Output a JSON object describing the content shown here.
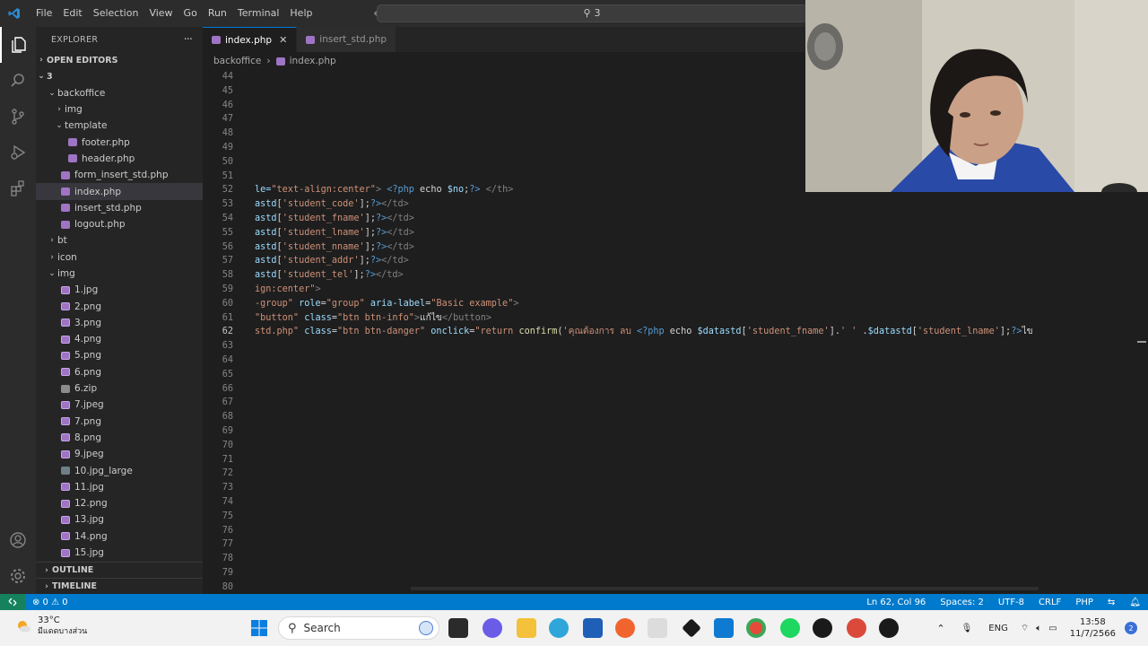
{
  "menu": [
    "File",
    "Edit",
    "Selection",
    "View",
    "Go",
    "Run",
    "Terminal",
    "Help"
  ],
  "command_center": "3",
  "explorer": {
    "title": "EXPLORER",
    "more": "···",
    "open_editors": "OPEN EDITORS",
    "root": "3",
    "tree": [
      {
        "label": "backoffice",
        "depth": 1,
        "kind": "folder-open"
      },
      {
        "label": "img",
        "depth": 2,
        "kind": "folder"
      },
      {
        "label": "template",
        "depth": 2,
        "kind": "folder-open"
      },
      {
        "label": "footer.php",
        "depth": 3,
        "kind": "php"
      },
      {
        "label": "header.php",
        "depth": 3,
        "kind": "php"
      },
      {
        "label": "form_insert_std.php",
        "depth": 2,
        "kind": "php"
      },
      {
        "label": "index.php",
        "depth": 2,
        "kind": "php",
        "selected": true
      },
      {
        "label": "insert_std.php",
        "depth": 2,
        "kind": "php"
      },
      {
        "label": "logout.php",
        "depth": 2,
        "kind": "php"
      },
      {
        "label": "bt",
        "depth": 1,
        "kind": "folder"
      },
      {
        "label": "icon",
        "depth": 1,
        "kind": "folder"
      },
      {
        "label": "img",
        "depth": 1,
        "kind": "folder-open"
      },
      {
        "label": "1.jpg",
        "depth": 2,
        "kind": "img"
      },
      {
        "label": "2.png",
        "depth": 2,
        "kind": "img"
      },
      {
        "label": "3.png",
        "depth": 2,
        "kind": "img"
      },
      {
        "label": "4.png",
        "depth": 2,
        "kind": "img"
      },
      {
        "label": "5.png",
        "depth": 2,
        "kind": "img"
      },
      {
        "label": "6.png",
        "depth": 2,
        "kind": "img"
      },
      {
        "label": "6.zip",
        "depth": 2,
        "kind": "zip"
      },
      {
        "label": "7.jpeg",
        "depth": 2,
        "kind": "img"
      },
      {
        "label": "7.png",
        "depth": 2,
        "kind": "img"
      },
      {
        "label": "8.png",
        "depth": 2,
        "kind": "img"
      },
      {
        "label": "9.jpeg",
        "depth": 2,
        "kind": "img"
      },
      {
        "label": "10.jpg_large",
        "depth": 2,
        "kind": "file"
      },
      {
        "label": "11.jpg",
        "depth": 2,
        "kind": "img"
      },
      {
        "label": "12.png",
        "depth": 2,
        "kind": "img"
      },
      {
        "label": "13.jpg",
        "depth": 2,
        "kind": "img"
      },
      {
        "label": "14.png",
        "depth": 2,
        "kind": "img"
      },
      {
        "label": "15.jpg",
        "depth": 2,
        "kind": "img"
      }
    ],
    "outline": "OUTLINE",
    "timeline": "TIMELINE"
  },
  "tabs": [
    {
      "label": "index.php",
      "active": true,
      "close": "✕"
    },
    {
      "label": "insert_std.php",
      "active": false
    }
  ],
  "breadcrumb": {
    "folder": "backoffice",
    "sep": "›",
    "file": "index.php"
  },
  "code_lines": [
    {
      "n": "44",
      "tokens": []
    },
    {
      "n": "45",
      "tokens": []
    },
    {
      "n": "46",
      "tokens": []
    },
    {
      "n": "47",
      "tokens": []
    },
    {
      "n": "48",
      "tokens": []
    },
    {
      "n": "49",
      "tokens": []
    },
    {
      "n": "50",
      "tokens": []
    },
    {
      "n": "51",
      "tokens": []
    },
    {
      "n": "52",
      "tokens": [
        [
          "attr",
          "le="
        ],
        [
          "str",
          "\"text-align:center\""
        ],
        [
          "tag",
          "> "
        ],
        [
          "php",
          "<?php "
        ],
        [
          "plain",
          "echo "
        ],
        [
          "var",
          "$no"
        ],
        [
          "plain",
          ";"
        ],
        [
          "php",
          "?>"
        ],
        [
          "tag",
          " </th>"
        ]
      ]
    },
    {
      "n": "53",
      "tokens": [
        [
          "var",
          "astd"
        ],
        [
          "plain",
          "["
        ],
        [
          "str",
          "'student_code'"
        ],
        [
          "plain",
          "];"
        ],
        [
          "php",
          "?>"
        ],
        [
          "tag",
          "</td>"
        ]
      ]
    },
    {
      "n": "54",
      "tokens": [
        [
          "var",
          "astd"
        ],
        [
          "plain",
          "["
        ],
        [
          "str",
          "'student_fname'"
        ],
        [
          "plain",
          "];"
        ],
        [
          "php",
          "?>"
        ],
        [
          "tag",
          "</td>"
        ]
      ]
    },
    {
      "n": "55",
      "tokens": [
        [
          "var",
          "astd"
        ],
        [
          "plain",
          "["
        ],
        [
          "str",
          "'student_lname'"
        ],
        [
          "plain",
          "];"
        ],
        [
          "php",
          "?>"
        ],
        [
          "tag",
          "</td>"
        ]
      ]
    },
    {
      "n": "56",
      "tokens": [
        [
          "var",
          "astd"
        ],
        [
          "plain",
          "["
        ],
        [
          "str",
          "'student_nname'"
        ],
        [
          "plain",
          "];"
        ],
        [
          "php",
          "?>"
        ],
        [
          "tag",
          "</td>"
        ]
      ]
    },
    {
      "n": "57",
      "tokens": [
        [
          "var",
          "astd"
        ],
        [
          "plain",
          "["
        ],
        [
          "str",
          "'student_addr'"
        ],
        [
          "plain",
          "];"
        ],
        [
          "php",
          "?>"
        ],
        [
          "tag",
          "</td>"
        ]
      ]
    },
    {
      "n": "58",
      "tokens": [
        [
          "var",
          "astd"
        ],
        [
          "plain",
          "["
        ],
        [
          "str",
          "'student_tel'"
        ],
        [
          "plain",
          "];"
        ],
        [
          "php",
          "?>"
        ],
        [
          "tag",
          "</td>"
        ]
      ]
    },
    {
      "n": "59",
      "tokens": [
        [
          "str",
          "ign:center\""
        ],
        [
          "tag",
          ">"
        ]
      ]
    },
    {
      "n": "60",
      "tokens": [
        [
          "str",
          "-group\" "
        ],
        [
          "attr",
          "role"
        ],
        [
          "plain",
          "="
        ],
        [
          "str",
          "\"group\" "
        ],
        [
          "attr",
          "aria-label"
        ],
        [
          "plain",
          "="
        ],
        [
          "str",
          "\"Basic example\""
        ],
        [
          "tag",
          ">"
        ]
      ]
    },
    {
      "n": "61",
      "tokens": [
        [
          "str",
          "\"button\" "
        ],
        [
          "attr",
          "class"
        ],
        [
          "plain",
          "="
        ],
        [
          "str",
          "\"btn btn-info\""
        ],
        [
          "tag",
          ">"
        ],
        [
          "plain",
          "แก้ไข"
        ],
        [
          "tag",
          "</button>"
        ]
      ]
    },
    {
      "n": "62",
      "current": true,
      "tokens": [
        [
          "str",
          "std.php\" "
        ],
        [
          "attr",
          "class"
        ],
        [
          "plain",
          "="
        ],
        [
          "str",
          "\"btn btn-danger\" "
        ],
        [
          "attr",
          "onclick"
        ],
        [
          "plain",
          "="
        ],
        [
          "str",
          "\"return "
        ],
        [
          "fn",
          "confirm"
        ],
        [
          "plain",
          "("
        ],
        [
          "str",
          "'คุณต้องการ ลบ "
        ],
        [
          "php",
          "<?php "
        ],
        [
          "plain",
          "echo "
        ],
        [
          "var",
          "$datastd"
        ],
        [
          "plain",
          "["
        ],
        [
          "str",
          "'student_fname'"
        ],
        [
          "plain",
          "]."
        ],
        [
          "str",
          "' ' "
        ],
        [
          "plain",
          "."
        ],
        [
          "var",
          "$datastd"
        ],
        [
          "plain",
          "["
        ],
        [
          "str",
          "'student_lname'"
        ],
        [
          "plain",
          "];"
        ],
        [
          "php",
          "?>"
        ],
        [
          "plain",
          "ไข"
        ]
      ]
    },
    {
      "n": "63",
      "tokens": []
    },
    {
      "n": "64",
      "tokens": []
    },
    {
      "n": "65",
      "tokens": []
    },
    {
      "n": "66",
      "tokens": []
    },
    {
      "n": "67",
      "tokens": []
    },
    {
      "n": "68",
      "tokens": []
    },
    {
      "n": "69",
      "tokens": []
    },
    {
      "n": "70",
      "tokens": []
    },
    {
      "n": "71",
      "tokens": []
    },
    {
      "n": "72",
      "tokens": []
    },
    {
      "n": "73",
      "tokens": []
    },
    {
      "n": "74",
      "tokens": []
    },
    {
      "n": "75",
      "tokens": []
    },
    {
      "n": "76",
      "tokens": []
    },
    {
      "n": "77",
      "tokens": []
    },
    {
      "n": "78",
      "tokens": []
    },
    {
      "n": "79",
      "tokens": []
    },
    {
      "n": "80",
      "tokens": []
    }
  ],
  "statusbar": {
    "problems": "⊗ 0 ⚠ 0",
    "position": "Ln 62, Col 96",
    "spaces": "Spaces: 2",
    "encoding": "UTF-8",
    "eol": "CRLF",
    "language": "PHP"
  },
  "taskbar": {
    "weather_temp": "33°C",
    "weather_desc": "มีแดดบางส่วน",
    "search": "Search",
    "lang": "ENG",
    "time": "13:58",
    "date": "11/7/2566",
    "notifications": "2"
  },
  "colors": {
    "accent": "#007acc",
    "editor_bg": "#1e1e1e",
    "sidebar_bg": "#252526"
  }
}
